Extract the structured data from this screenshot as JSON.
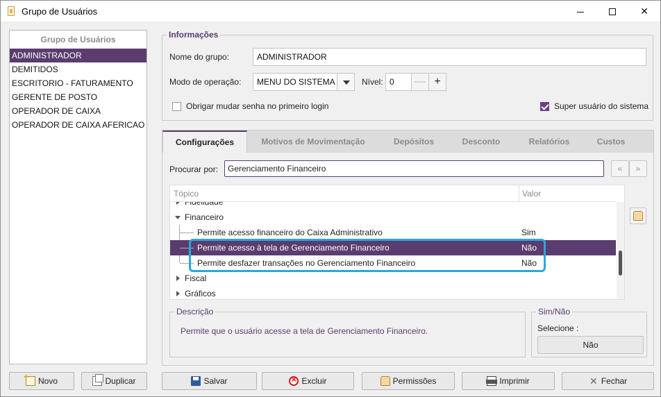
{
  "window": {
    "title": "Grupo de Usuários"
  },
  "groups": {
    "header": "Grupo de Usuários",
    "items": [
      "ADMINISTRADOR",
      "DEMITIDOS",
      "ESCRITORIO - FATURAMENTO",
      "GERENTE DE POSTO",
      "OPERADOR DE CAIXA",
      "OPERADOR DE CAIXA AFERICAO"
    ],
    "selected": "ADMINISTRADOR"
  },
  "left_buttons": {
    "new": "Novo",
    "duplicate": "Duplicar"
  },
  "info": {
    "title": "Informações",
    "name_label": "Nome do grupo:",
    "name_value": "ADMINISTRADOR",
    "mode_label": "Modo de operação:",
    "mode_value": "MENU DO SISTEMA",
    "level_label": "Nível:",
    "level_value": "0",
    "level_minus": "—",
    "level_plus": "+",
    "force_pw_label": "Obrigar mudar senha no primeiro login",
    "force_pw_checked": false,
    "super_user_label": "Super usuário do sistema",
    "super_user_checked": true
  },
  "tabs": [
    {
      "label": "Configurações",
      "active": true
    },
    {
      "label": "Motivos de Movimentação",
      "active": false
    },
    {
      "label": "Depósitos",
      "active": false
    },
    {
      "label": "Desconto",
      "active": false
    },
    {
      "label": "Relatórios",
      "active": false
    },
    {
      "label": "Custos",
      "active": false
    }
  ],
  "config": {
    "search_label": "Procurar por:",
    "search_value": "Gerenciamento Financeiro",
    "column_topic": "Tópico",
    "column_value": "Valor",
    "rows": [
      {
        "text": "Fidelidade",
        "value": "",
        "kind": "collapsed"
      },
      {
        "text": "Financeiro",
        "value": "",
        "kind": "expanded"
      },
      {
        "text": "Permite acesso financeiro do Caixa Administrativo",
        "value": "Sim",
        "kind": "child"
      },
      {
        "text": "Permite acesso à tela de Gerenciamento Financeiro",
        "value": "Não",
        "kind": "child",
        "selected": true
      },
      {
        "text": "Permite desfazer transações no Gerenciamento Financeiro",
        "value": "Não",
        "kind": "child"
      },
      {
        "text": "Fiscal",
        "value": "",
        "kind": "collapsed"
      },
      {
        "text": "Gráficos",
        "value": "",
        "kind": "collapsed"
      }
    ],
    "description_title": "Descrição",
    "description_text": "Permite que o usuário acesse a tela de Gerenciamento Financeiro.",
    "simnao_title": "Sim/Não",
    "simnao_select_label": "Selecione :",
    "simnao_value": "Não"
  },
  "bottom_buttons": {
    "save": "Salvar",
    "delete": "Excluir",
    "permissions": "Permissões",
    "print": "Imprimir",
    "close": "Fechar"
  },
  "colors": {
    "accent": "#5a3d6e",
    "highlight": "#29a8e0"
  }
}
